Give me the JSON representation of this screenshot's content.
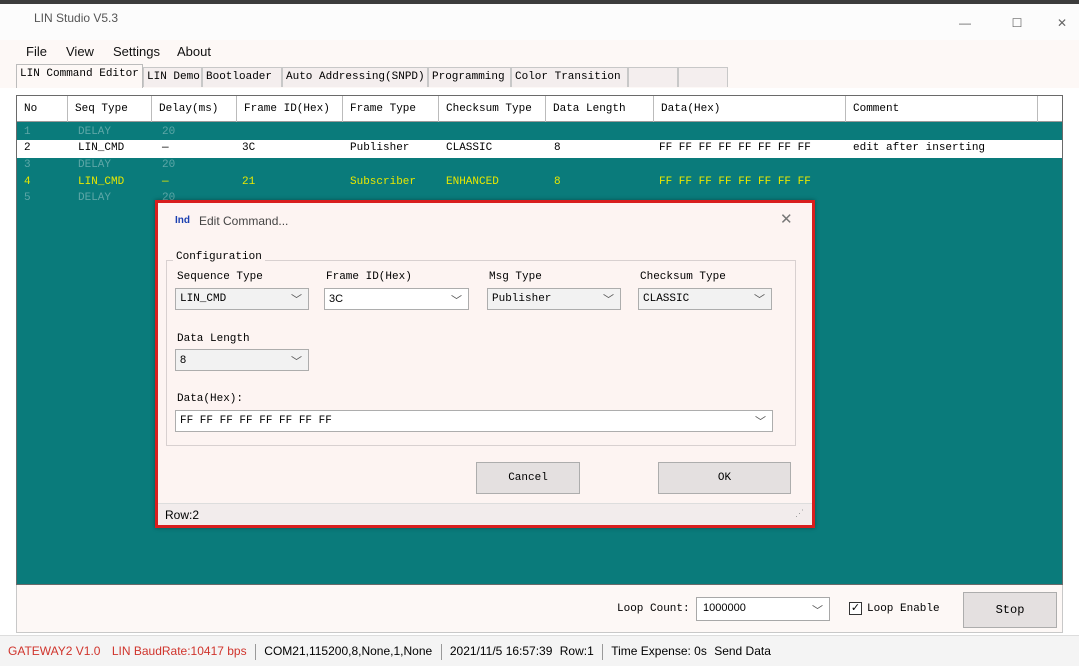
{
  "window": {
    "title": "LIN Studio V5.3",
    "minimize": "—",
    "maximize": "☐",
    "close": "✕"
  },
  "menu": [
    "File",
    "View",
    "Settings",
    "About"
  ],
  "tabs": [
    "LIN Command Editor",
    "LIN Demo",
    "Bootloader",
    "Auto Addressing(SNPD)",
    "Programming",
    "Color Transition"
  ],
  "grid": {
    "columns": [
      "No",
      "Seq Type",
      "Delay(ms)",
      "Frame ID(Hex)",
      "Frame Type",
      "Checksum Type",
      "Data Length",
      "Data(Hex)",
      "Comment"
    ],
    "rows": [
      {
        "no": "1",
        "seq": "DELAY",
        "delay": "20",
        "frame_id": "",
        "frame_type": "",
        "checksum": "",
        "length": "",
        "data": "",
        "comment": ""
      },
      {
        "no": "2",
        "seq": "LIN_CMD",
        "delay": "—",
        "frame_id": "3C",
        "frame_type": "Publisher",
        "checksum": "CLASSIC",
        "length": "8",
        "data": "FF FF FF FF FF FF FF FF",
        "comment": "edit after inserting"
      },
      {
        "no": "3",
        "seq": "DELAY",
        "delay": "20",
        "frame_id": "",
        "frame_type": "",
        "checksum": "",
        "length": "",
        "data": "",
        "comment": ""
      },
      {
        "no": "4",
        "seq": "LIN_CMD",
        "delay": "—",
        "frame_id": "21",
        "frame_type": "Subscriber",
        "checksum": "ENHANCED",
        "length": "8",
        "data": "FF FF FF FF FF FF FF FF",
        "comment": ""
      },
      {
        "no": "5",
        "seq": "DELAY",
        "delay": "20",
        "frame_id": "",
        "frame_type": "",
        "checksum": "",
        "length": "",
        "data": "",
        "comment": ""
      }
    ]
  },
  "dialog": {
    "icon_text": "Ind",
    "title": "Edit Command...",
    "group_label": "Configuration",
    "sequence_type": {
      "label": "Sequence Type",
      "value": "LIN_CMD"
    },
    "frame_id": {
      "label": "Frame ID(Hex)",
      "value": "3C"
    },
    "msg_type": {
      "label": "Msg Type",
      "value": "Publisher"
    },
    "checksum_type": {
      "label": "Checksum Type",
      "value": "CLASSIC"
    },
    "data_length": {
      "label": "Data Length",
      "value": "8"
    },
    "data_hex": {
      "label": "Data(Hex):",
      "value": "FF FF FF FF FF FF FF FF"
    },
    "cancel": "Cancel",
    "ok": "OK",
    "status": "Row:2"
  },
  "controls": {
    "loop_count_label": "Loop Count:",
    "loop_count_value": "1000000",
    "loop_enable_label": "Loop Enable",
    "loop_enable_checked": true,
    "stop": "Stop"
  },
  "status": {
    "gateway": "GATEWAY2 V1.0",
    "baud": "LIN BaudRate:10417 bps",
    "port": "COM21,115200,8,None,1,None",
    "datetime": "2021/11/5 16:57:39",
    "row": "Row:1",
    "expense": "Time Expense: 0s",
    "action": "Send Data"
  },
  "colors": {
    "grid_bg": "#0a7b7b",
    "highlight_yellow": "#e8e800",
    "status_red": "#d0342c",
    "dialog_border": "#d81e1e"
  }
}
